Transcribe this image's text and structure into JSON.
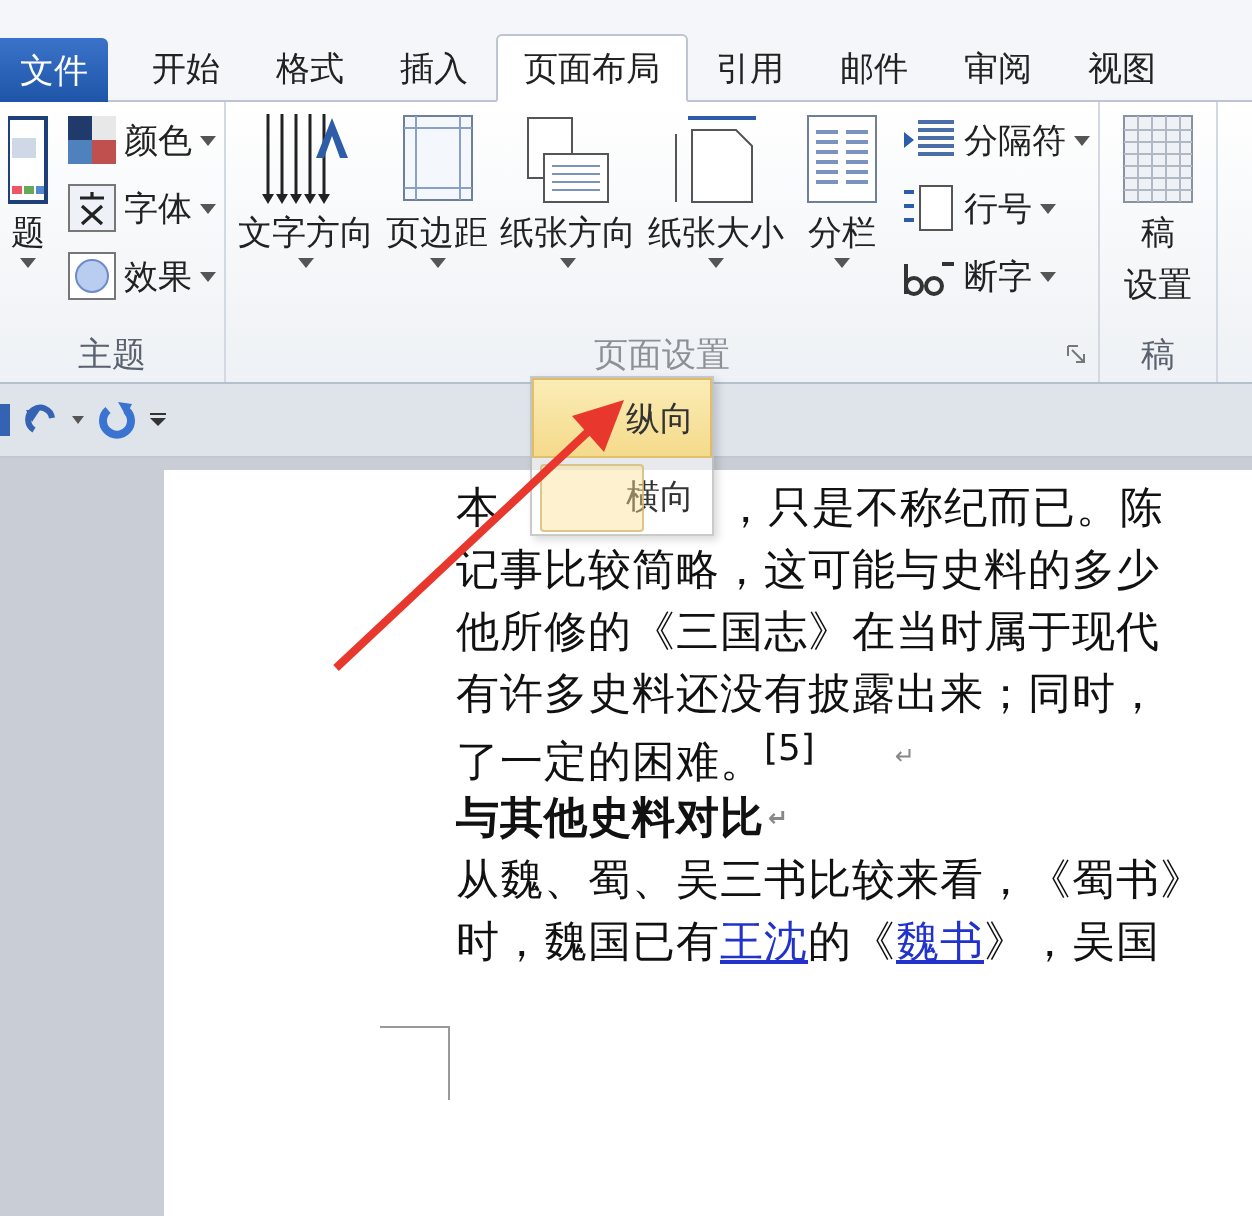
{
  "tabs": [
    {
      "label": "文件",
      "kind": "file",
      "selected": false
    },
    {
      "label": "开始",
      "kind": "tab",
      "selected": false
    },
    {
      "label": "格式",
      "kind": "tab",
      "selected": false
    },
    {
      "label": "插入",
      "kind": "tab",
      "selected": false
    },
    {
      "label": "页面布局",
      "kind": "tab",
      "selected": true
    },
    {
      "label": "引用",
      "kind": "tab",
      "selected": false
    },
    {
      "label": "邮件",
      "kind": "tab",
      "selected": false
    },
    {
      "label": "审阅",
      "kind": "tab",
      "selected": false
    },
    {
      "label": "视图",
      "kind": "tab",
      "selected": false
    }
  ],
  "ribbon": {
    "groups": [
      {
        "label": "主题",
        "launcher": false,
        "items": [
          {
            "kind": "large",
            "lines": [
              "题"
            ],
            "dropdown": true
          },
          {
            "kind": "small",
            "label": "颜色",
            "dropdown": true
          },
          {
            "kind": "small",
            "label": "字体",
            "dropdown": true
          },
          {
            "kind": "small",
            "label": "效果",
            "dropdown": true
          }
        ]
      },
      {
        "label": "页面设置",
        "launcher": true,
        "items": [
          {
            "kind": "large",
            "lines": [
              "文字方向"
            ],
            "dropdown": true
          },
          {
            "kind": "large",
            "lines": [
              "页边距"
            ],
            "dropdown": true
          },
          {
            "kind": "large",
            "lines": [
              "纸张方向"
            ],
            "dropdown": true
          },
          {
            "kind": "large",
            "lines": [
              "纸张大小"
            ],
            "dropdown": true
          },
          {
            "kind": "large",
            "lines": [
              "分栏"
            ],
            "dropdown": true
          },
          {
            "kind": "small",
            "label": "分隔符",
            "dropdown": true
          },
          {
            "kind": "small",
            "label": "行号",
            "dropdown": true
          },
          {
            "kind": "small",
            "label": "断字",
            "dropdown": true
          }
        ]
      },
      {
        "label": "稿",
        "launcher": false,
        "items": [
          {
            "kind": "large",
            "lines": [
              "稿",
              "设置"
            ],
            "dropdown": false
          }
        ]
      }
    ]
  },
  "menu": {
    "items": [
      {
        "label": "纵向",
        "selected": true
      },
      {
        "label": "横向",
        "selected": false
      }
    ]
  },
  "document": {
    "lines": [
      {
        "kind": "text",
        "segments": [
          {
            "text": "本",
            "link": false
          },
          {
            "text": "，只是不称纪而已。陈",
            "link": false,
            "covered_before": true
          }
        ]
      },
      {
        "kind": "text",
        "segments": [
          {
            "text": "记事比较简略，这可能与史料的多少",
            "link": false
          }
        ]
      },
      {
        "kind": "text",
        "segments": [
          {
            "text": "他所修的《三国志》在当时属于现代",
            "link": false
          }
        ]
      },
      {
        "kind": "text",
        "segments": [
          {
            "text": "有许多史料还没有披露出来；同时，",
            "link": false
          }
        ]
      },
      {
        "kind": "text",
        "mark": "↵",
        "segments": [
          {
            "text": "了一定的困难。$^{[5]}$",
            "link": false
          }
        ]
      },
      {
        "kind": "heading",
        "mark": "↵",
        "segments": [
          {
            "text": "与其他史料对比",
            "link": false
          }
        ]
      },
      {
        "kind": "text",
        "segments": [
          {
            "text": "从魏、蜀、吴三书比较来看，《蜀书》",
            "link": false
          }
        ]
      },
      {
        "kind": "text",
        "segments": [
          {
            "text": "时，魏国已有",
            "link": false
          },
          {
            "text": "王沈",
            "link": true
          },
          {
            "text": "的《",
            "link": false
          },
          {
            "text": "魏书",
            "link": true
          },
          {
            "text": "》，吴国",
            "link": false
          }
        ]
      }
    ]
  }
}
